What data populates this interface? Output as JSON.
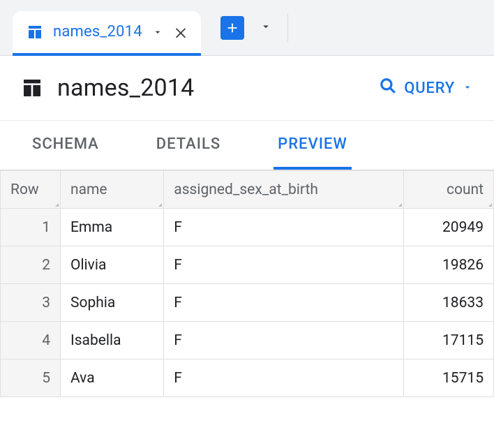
{
  "tab": {
    "label": "names_2014"
  },
  "title": "names_2014",
  "query_label": "QUERY",
  "section_tabs": {
    "schema": "SCHEMA",
    "details": "DETAILS",
    "preview": "PREVIEW"
  },
  "columns": {
    "row": "Row",
    "name": "name",
    "sex": "assigned_sex_at_birth",
    "count": "count"
  },
  "rows": [
    {
      "row": "1",
      "name": "Emma",
      "sex": "F",
      "count": "20949"
    },
    {
      "row": "2",
      "name": "Olivia",
      "sex": "F",
      "count": "19826"
    },
    {
      "row": "3",
      "name": "Sophia",
      "sex": "F",
      "count": "18633"
    },
    {
      "row": "4",
      "name": "Isabella",
      "sex": "F",
      "count": "17115"
    },
    {
      "row": "5",
      "name": "Ava",
      "sex": "F",
      "count": "15715"
    }
  ]
}
